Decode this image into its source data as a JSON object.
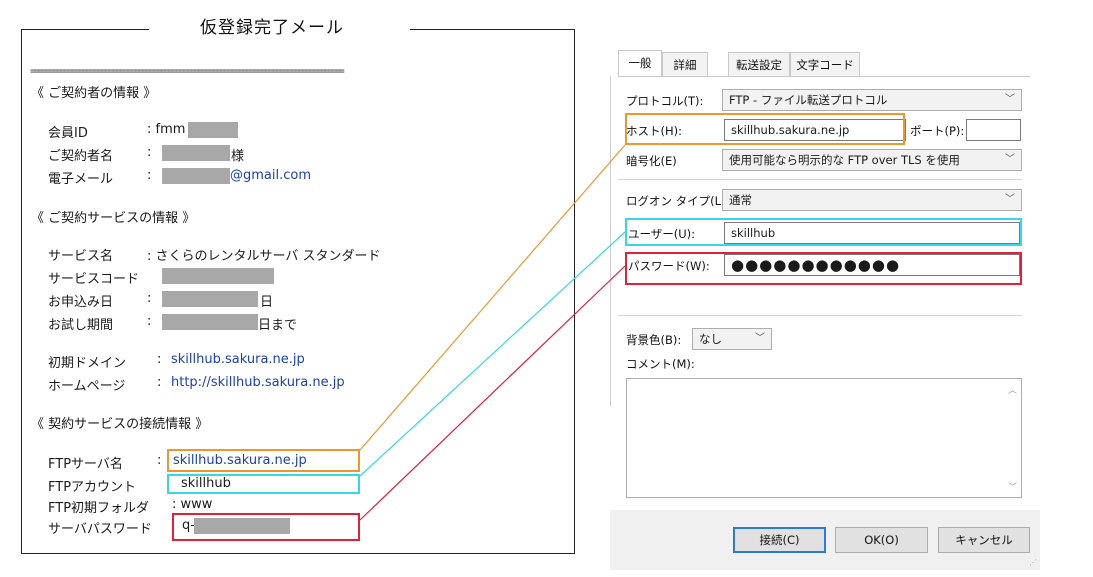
{
  "email": {
    "title": "仮登録完了メール",
    "separator": "====================================================================================",
    "section_contractor": "《 ご契約者の情報 》",
    "member_id_label": "会員ID",
    "member_id_value": ": fmm",
    "contractor_name_label": "ご契約者名",
    "contractor_name_colon": ":",
    "contractor_name_suffix": "様",
    "email_label": "電子メール",
    "email_colon": ":",
    "email_value": "@gmail.com",
    "section_service": "《 ご契約サービスの情報 》",
    "service_name_label": "サービス名",
    "service_name_value": ": さくらのレンタルサーバ スタンダード",
    "service_code_label": "サービスコード",
    "apply_date_label": "お申込み日",
    "apply_date_colon": ":",
    "apply_date_suffix": "日",
    "trial_label": "お試し期間",
    "trial_colon": ":",
    "trial_suffix": "日まで",
    "initial_domain_label": "初期ドメイン",
    "initial_domain_colon": ":",
    "initial_domain_value": "skillhub.sakura.ne.jp",
    "homepage_label": "ホームページ",
    "homepage_colon": ":",
    "homepage_value": "http://skillhub.sakura.ne.jp",
    "section_connection": "《 契約サービスの接続情報 》",
    "ftp_server_label": "FTPサーバ名",
    "ftp_server_colon": ":",
    "ftp_server_value": "skillhub.sakura.ne.jp",
    "ftp_account_label": "FTPアカウント",
    "ftp_account_value": "skillhub",
    "ftp_folder_label": "FTP初期フォルダ",
    "ftp_folder_value": ": www",
    "server_password_label": "サーバパスワード",
    "server_password_value": "q-"
  },
  "dialog": {
    "tabs": [
      "一般",
      "詳細",
      "転送設定",
      "文字コード"
    ],
    "protocol_label": "プロトコル(T):",
    "protocol_value": "FTP - ファイル転送プロトコル",
    "host_label": "ホスト(H):",
    "host_value": "skillhub.sakura.ne.jp",
    "port_label": "ポート(P):",
    "port_value": "",
    "encryption_label": "暗号化(E)",
    "encryption_value": "使用可能なら明示的な FTP over TLS を使用",
    "logon_type_label": "ログオン タイプ(L):",
    "logon_type_value": "通常",
    "user_label": "ユーザー(U):",
    "user_value": "skillhub",
    "password_label": "パスワード(W):",
    "password_value": "●●●●●●●●●●●●",
    "bg_color_label": "背景色(B):",
    "bg_color_value": "なし",
    "comment_label": "コメント(M):",
    "buttons": {
      "connect": "接続(C)",
      "ok": "OK(O)",
      "cancel": "キャンセル"
    }
  },
  "colors": {
    "highlight_host": "#f0962e",
    "highlight_user": "#34d8e8",
    "highlight_password": "#e2203a",
    "link": "#1a3fb8",
    "default_button_border": "#2a7ad6"
  }
}
